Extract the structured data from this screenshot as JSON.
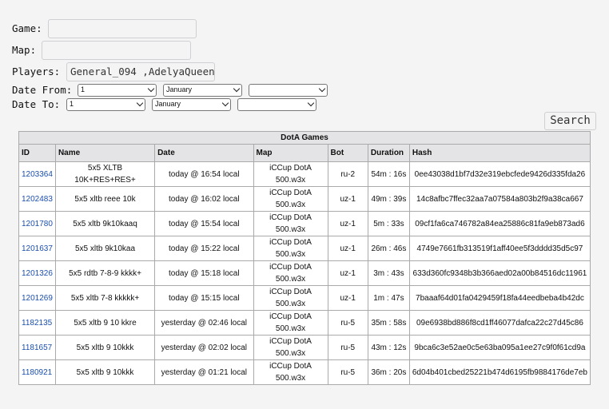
{
  "form": {
    "game_label": "Game:",
    "game_value": "",
    "map_label": "Map:",
    "map_value": "",
    "players_label": "Players:",
    "players_value": "General_094 ,AdelyaQueen",
    "date_from_label": "Date From:",
    "date_to_label": "Date To:",
    "from_day": "1",
    "from_month": "January",
    "from_year": "",
    "to_day": "1",
    "to_month": "January",
    "to_year": "",
    "search_label": "Search"
  },
  "table": {
    "caption": "DotA Games",
    "headers": [
      "ID",
      "Name",
      "Date",
      "Map",
      "Bot",
      "Duration",
      "Hash"
    ],
    "rows": [
      {
        "id": "1203364",
        "name": "5x5 XLTB 10K+RES+RES+",
        "date": "today @ 16:54 local",
        "map": "iCCup DotA 500.w3x",
        "bot": "ru-2",
        "duration": "54m : 16s",
        "hash": "0ee43038d1bf7d32e319ebcfede9426d335fda26"
      },
      {
        "id": "1202483",
        "name": "5x5 xltb reee 10k",
        "date": "today @ 16:02 local",
        "map": "iCCup DotA 500.w3x",
        "bot": "uz-1",
        "duration": "49m : 39s",
        "hash": "14c8afbc7ffec32aa7a07584a803b2f9a38ca667"
      },
      {
        "id": "1201780",
        "name": "5x5 xltb 9k10kaaq",
        "date": "today @ 15:54 local",
        "map": "iCCup DotA 500.w3x",
        "bot": "uz-1",
        "duration": "5m : 33s",
        "hash": "09cf1fa6ca746782a84ea25886c81fa9eb873ad6"
      },
      {
        "id": "1201637",
        "name": "5x5 xltb 9k10kaa",
        "date": "today @ 15:22 local",
        "map": "iCCup DotA 500.w3x",
        "bot": "uz-1",
        "duration": "26m : 46s",
        "hash": "4749e7661fb313519f1aff40ee5f3dddd35d5c97"
      },
      {
        "id": "1201326",
        "name": "5x5 rdtb 7-8-9 kkkk+",
        "date": "today @ 15:18 local",
        "map": "iCCup DotA 500.w3x",
        "bot": "uz-1",
        "duration": "3m : 43s",
        "hash": "633d360fc9348b3b366aed02a00b84516dc11961"
      },
      {
        "id": "1201269",
        "name": "5x5 xltb 7-8 kkkkk+",
        "date": "today @ 15:15 local",
        "map": "iCCup DotA 500.w3x",
        "bot": "uz-1",
        "duration": "1m : 47s",
        "hash": "7baaaf64d01fa0429459f18fa44eedbeba4b42dc"
      },
      {
        "id": "1182135",
        "name": "5x5 xltb 9 10 kkre",
        "date": "yesterday @ 02:46 local",
        "map": "iCCup DotA 500.w3x",
        "bot": "ru-5",
        "duration": "35m : 58s",
        "hash": "09e6938bd886f8cd1ff46077dafca22c27d45c86"
      },
      {
        "id": "1181657",
        "name": "5x5 xltb 9 10kkk",
        "date": "yesterday @ 02:02 local",
        "map": "iCCup DotA 500.w3x",
        "bot": "ru-5",
        "duration": "43m : 12s",
        "hash": "9bca6c3e52ae0c5e63ba095a1ee27c9f0f61cd9a"
      },
      {
        "id": "1180921",
        "name": "5x5 xltb 9 10kkk",
        "date": "yesterday @ 01:21 local",
        "map": "iCCup DotA 500.w3x",
        "bot": "ru-5",
        "duration": "36m : 20s",
        "hash": "6d04b401cbed25221b474d6195fb9884176de7eb"
      }
    ]
  }
}
